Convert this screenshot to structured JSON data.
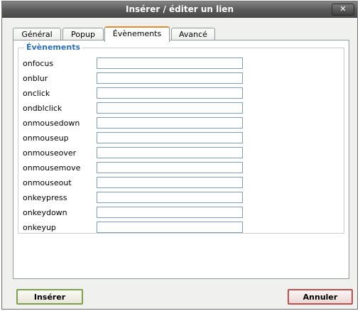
{
  "dialog": {
    "title": "Insérer / éditer un lien",
    "close_label": "✕"
  },
  "tabs": [
    {
      "label": "Général"
    },
    {
      "label": "Popup"
    },
    {
      "label": "Évènements"
    },
    {
      "label": "Avancé"
    }
  ],
  "active_tab": "Évènements",
  "events": {
    "legend": "Évènements",
    "fields": [
      {
        "label": "onfocus",
        "value": ""
      },
      {
        "label": "onblur",
        "value": ""
      },
      {
        "label": "onclick",
        "value": ""
      },
      {
        "label": "ondblclick",
        "value": ""
      },
      {
        "label": "onmousedown",
        "value": ""
      },
      {
        "label": "onmouseup",
        "value": ""
      },
      {
        "label": "onmouseover",
        "value": ""
      },
      {
        "label": "onmousemove",
        "value": ""
      },
      {
        "label": "onmouseout",
        "value": ""
      },
      {
        "label": "onkeypress",
        "value": ""
      },
      {
        "label": "onkeydown",
        "value": ""
      },
      {
        "label": "onkeyup",
        "value": ""
      }
    ]
  },
  "buttons": {
    "insert": "Insérer",
    "cancel": "Annuler"
  },
  "colors": {
    "legend": "#2b6fb6",
    "active_tab_accent": "#e68b2c",
    "insert_border": "#7ca14a",
    "cancel_border": "#c0504d"
  }
}
